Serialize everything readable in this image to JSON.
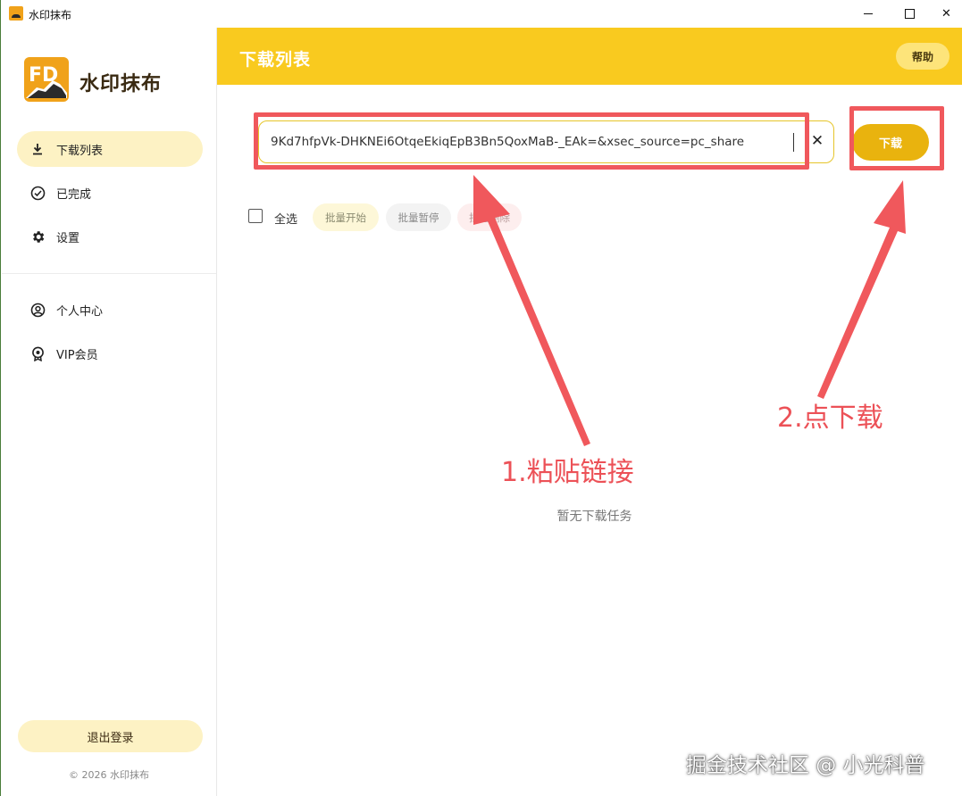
{
  "window": {
    "title": "水印抹布"
  },
  "sidebar": {
    "brand": "水印抹布",
    "items": [
      {
        "label": "下载列表",
        "icon": "download-icon",
        "active": true
      },
      {
        "label": "已完成",
        "icon": "check-circle-icon",
        "active": false
      },
      {
        "label": "设置",
        "icon": "gear-icon",
        "active": false
      },
      {
        "label": "个人中心",
        "icon": "user-circle-icon",
        "active": false
      },
      {
        "label": "VIP会员",
        "icon": "vip-badge-icon",
        "active": false
      }
    ],
    "logout_label": "退出登录",
    "copyright": "© 2026 水印抹布"
  },
  "header": {
    "title": "下载列表",
    "help_label": "帮助"
  },
  "url_input": {
    "value": "9Kd7hfpVk-DHKNEi6OtqeEkiqEpB3Bn5QoxMaB-_EAk=&xsec_source=pc_share",
    "clear_icon": "close-icon"
  },
  "download_label": "下载",
  "toolbar": {
    "select_all": "全选",
    "batch_start": "批量开始",
    "batch_pause": "批量暂停",
    "batch_delete": "批量删除"
  },
  "empty_text": "暂无下载任务",
  "annotations": {
    "step1": "1.粘贴链接",
    "step2": "2.点下载"
  },
  "watermark": "掘金技术社区 @ 小光科普",
  "colors": {
    "accent": "#f9ca1f",
    "download_button": "#e9b30e",
    "active_nav": "#fdf2c4",
    "annotation": "#f0585c"
  }
}
